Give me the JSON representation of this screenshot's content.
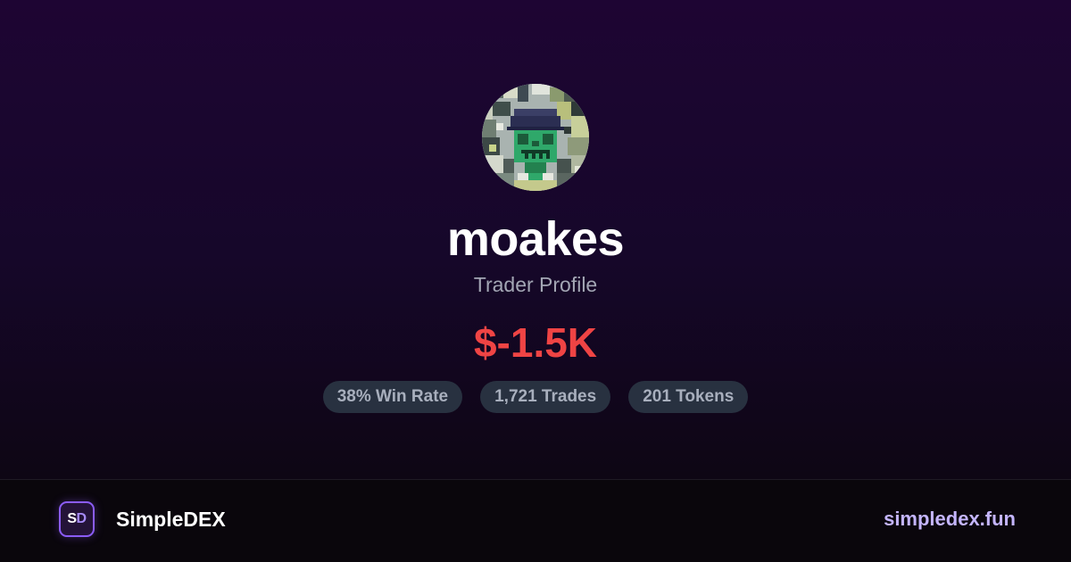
{
  "profile": {
    "username": "moakes",
    "subtitle": "Trader Profile",
    "avatar_icon": "pixel-art-skull-avatar",
    "pnl": "$-1.5K",
    "pnl_color": "#ef4444"
  },
  "stats": [
    {
      "label": "38% Win Rate"
    },
    {
      "label": "1,721 Trades"
    },
    {
      "label": "201 Tokens"
    }
  ],
  "footer": {
    "logo_letters": {
      "first": "S",
      "second": "D"
    },
    "brand": "SimpleDEX",
    "site": "simpledex.fun",
    "accent_color": "#8b5cf6"
  }
}
